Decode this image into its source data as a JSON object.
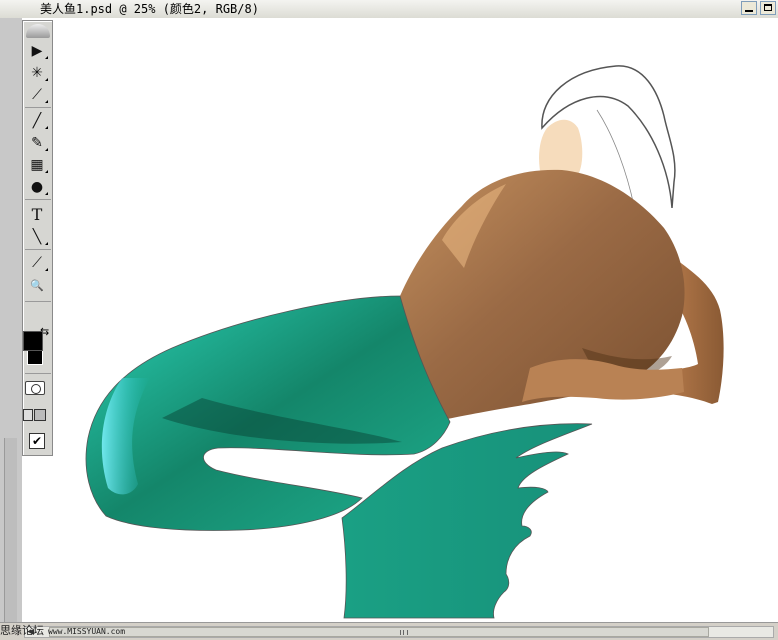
{
  "window": {
    "title": "美人鱼1.psd @ 25% (颜色2, RGB/8)"
  },
  "toolbox": {
    "tools": [
      {
        "name": "move-tool-icon",
        "glyph": "▶"
      },
      {
        "name": "magic-wand-icon",
        "glyph": "✳"
      },
      {
        "name": "crop-slice-icon",
        "glyph": "⟋"
      },
      {
        "name": "brush-icon",
        "glyph": "╱"
      },
      {
        "name": "history-brush-icon",
        "glyph": "✎"
      },
      {
        "name": "gradient-icon",
        "glyph": "▦"
      },
      {
        "name": "burn-tool-icon",
        "glyph": "●"
      },
      {
        "name": "type-tool-icon",
        "glyph": "T"
      },
      {
        "name": "line-tool-icon",
        "glyph": "╲"
      },
      {
        "name": "eyedropper-icon",
        "glyph": "⟋"
      },
      {
        "name": "zoom-icon",
        "glyph": "🔍"
      }
    ],
    "swap_glyph": "⇆",
    "jump_glyph": "✔"
  },
  "colors": {
    "foreground": "#000000",
    "background": "#000000",
    "skin_base": "#9a6a45",
    "skin_dark": "#6b4426",
    "skin_light": "#f0c490",
    "tail_base": "#1fae8e",
    "tail_dark": "#0a5a44",
    "tail_light": "#5ff0ff",
    "face": "#f6dcbc"
  },
  "watermark": {
    "text": "思缘论坛",
    "url": "www.MISSYUAN.com"
  }
}
